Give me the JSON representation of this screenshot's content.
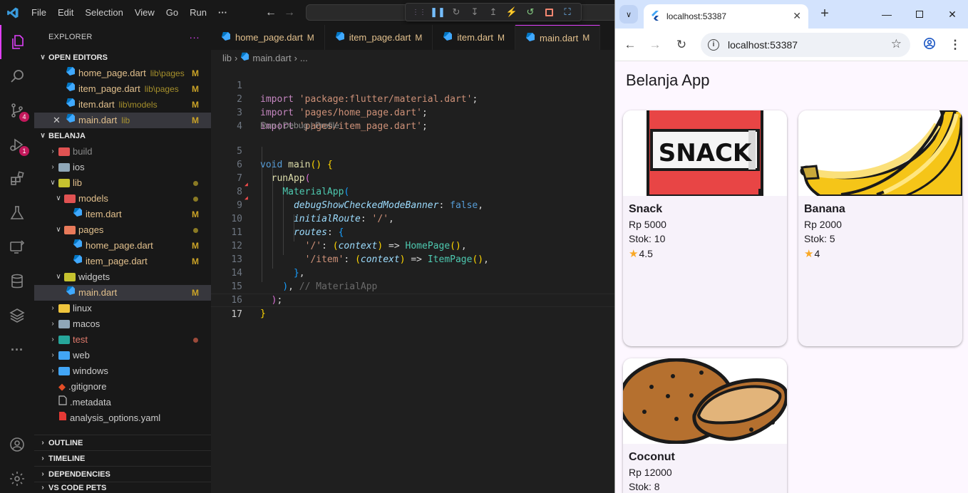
{
  "vscode": {
    "menu": [
      "File",
      "Edit",
      "Selection",
      "View",
      "Go",
      "Run"
    ],
    "more": "···",
    "activity_badges": {
      "source_control": "4",
      "run_debug": "1"
    },
    "sidebar": {
      "title": "EXPLORER",
      "open_editors_label": "OPEN EDITORS",
      "open_editors": [
        {
          "name": "home_page.dart",
          "path": "lib\\pages",
          "mark": "M"
        },
        {
          "name": "item_page.dart",
          "path": "lib\\pages",
          "mark": "M"
        },
        {
          "name": "item.dart",
          "path": "lib\\models",
          "mark": "M"
        },
        {
          "name": "main.dart",
          "path": "lib",
          "mark": "M"
        }
      ],
      "project_label": "BELANJA",
      "tree": {
        "build": "build",
        "ios": "ios",
        "lib": "lib",
        "models": "models",
        "item": "item.dart",
        "pages": "pages",
        "home_page": "home_page.dart",
        "item_page": "item_page.dart",
        "widgets": "widgets",
        "main": "main.dart",
        "linux": "linux",
        "macos": "macos",
        "test": "test",
        "web": "web",
        "windows": "windows",
        "gitignore": ".gitignore",
        "metadata": ".metadata",
        "analysis": "analysis_options.yaml",
        "m": "M"
      },
      "bottom_sections": [
        "OUTLINE",
        "TIMELINE",
        "DEPENDENCIES",
        "VS CODE PETS"
      ]
    },
    "tabs": [
      {
        "name": "home_page.dart",
        "mark": "M"
      },
      {
        "name": "item_page.dart",
        "mark": "M"
      },
      {
        "name": "item.dart",
        "mark": "M"
      },
      {
        "name": "main.dart",
        "mark": "M"
      }
    ],
    "breadcrumb": {
      "folder": "lib",
      "file": "main.dart",
      "tail": "..."
    },
    "codelens": "Run | Debug | Profile",
    "code": {
      "l1_kw": "import",
      "l1_str": "'package:flutter/material.dart'",
      "semi": ";",
      "l2_str": "'pages/home_page.dart'",
      "l3_str": "'pages/item_page.dart'",
      "l5_void": "void",
      "l5_main": "main",
      "l6": "runApp",
      "l7": "MaterialApp",
      "l8_prop": "debugShowCheckedModeBanner",
      "l8_val": "false",
      "l9_prop": "initialRoute",
      "l9_val": "'/'",
      "l10_prop": "routes",
      "l11_key": "'/'",
      "ctx": "context",
      "arrow": "=>",
      "l11_class": "HomePage",
      "l12_key": "'/item'",
      "l12_class": "ItemPage",
      "l14_comment": "// MaterialApp"
    },
    "line_numbers": [
      "1",
      "2",
      "3",
      "4",
      "5",
      "6",
      "7",
      "8",
      "9",
      "10",
      "11",
      "12",
      "13",
      "14",
      "15",
      "16",
      "17"
    ]
  },
  "browser": {
    "tab_title": "localhost:53387",
    "url": "localhost:53387",
    "app_title": "Belanja App",
    "items": [
      {
        "name": "Snack",
        "price": "Rp 5000",
        "stock": "Stok: 10",
        "rating": "4.5",
        "img_text": "SNACK"
      },
      {
        "name": "Banana",
        "price": "Rp 2000",
        "stock": "Stok: 5",
        "rating": "4"
      },
      {
        "name": "Coconut",
        "price": "Rp 12000",
        "stock": "Stok: 8"
      }
    ]
  }
}
